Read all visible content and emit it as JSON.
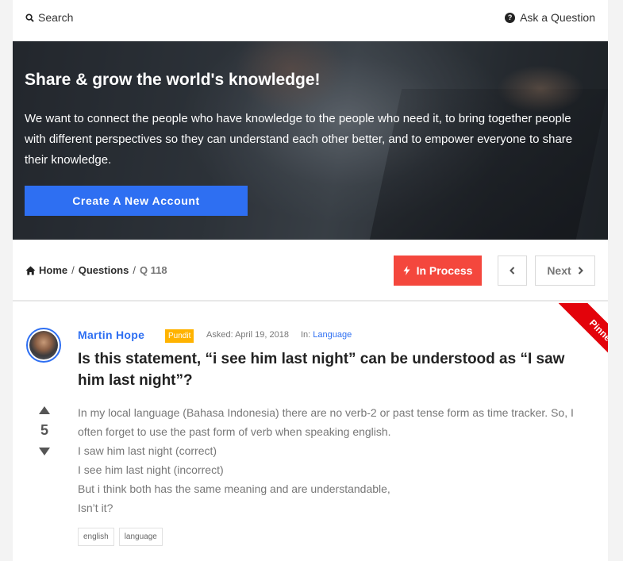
{
  "topbar": {
    "search_label": "Search",
    "ask_label": "Ask a Question",
    "ask_icon_glyph": "?"
  },
  "hero": {
    "title": "Share & grow the world's knowledge!",
    "text": "We want to connect the people who have knowledge to the people who need it, to bring together people with different perspectives so they can understand each other better, and to empower everyone to share their knowledge.",
    "cta_label": "Create A New Account"
  },
  "breadcrumb": {
    "home": "Home",
    "questions": "Questions",
    "current": "Q 118",
    "separator": "/"
  },
  "actions": {
    "status_label": "In Process",
    "next_label": "Next"
  },
  "ribbon": {
    "label": "Pinned"
  },
  "question": {
    "author": "Martin Hope",
    "badge": "Pundit",
    "asked": "Asked: April 19, 2018",
    "in_label": "In:",
    "category": "Language",
    "title": "Is this statement, “i see him last night” can be understood as “I saw him last night”?",
    "votes": "5",
    "body": [
      "In my local language (Bahasa Indonesia) there are no verb-2 or past tense form as time tracker. So, I often forget to use the past form of verb when speaking english.",
      "I saw him last night (correct)",
      "I see him last night (incorrect)",
      "But i think both has the same meaning and are understandable,",
      "Isn’t it?"
    ],
    "tags": [
      "english",
      "language"
    ]
  },
  "colors": {
    "accent": "#2e6ff2",
    "status": "#f4473d",
    "badge": "#ffb300",
    "ribbon": "#e3030b"
  }
}
